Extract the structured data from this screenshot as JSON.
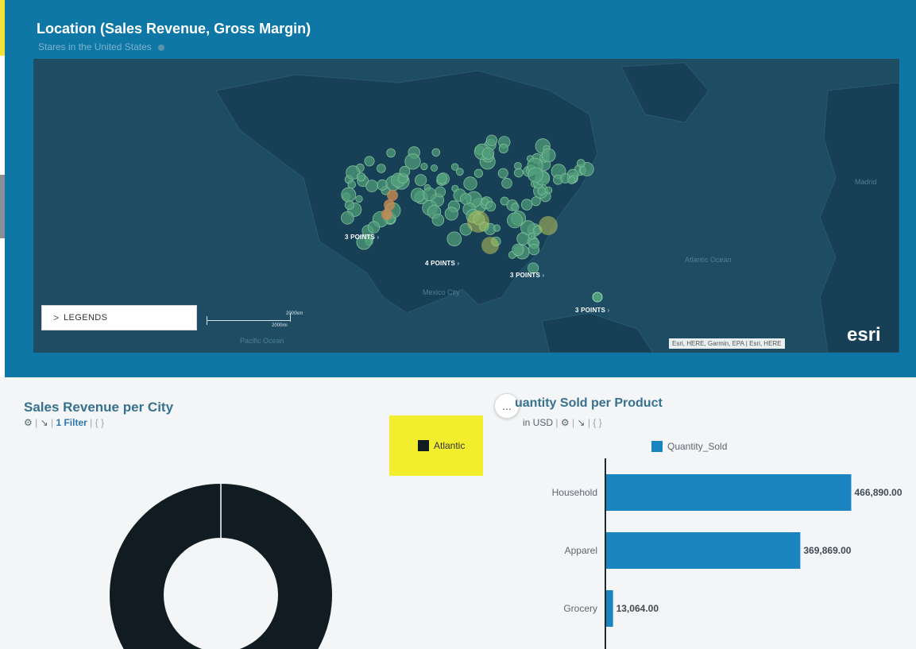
{
  "map": {
    "title": "Location (Sales Revenue, Gross Margin)",
    "subtitle": "Stares in the United States",
    "cluster_labels": [
      "3 POINTS",
      "4 POINTS",
      "3 POINTS",
      "3 POINTS"
    ],
    "ocean_labels": [
      "Atlantic Ocean",
      "Mexico City",
      "Pacific Ocean",
      "Madrid"
    ],
    "legends_label": "LEGENDS",
    "scale_km": "2000km",
    "scale_mi": "2000mi",
    "attribution": "Esri, HERE, Garmin, EPA | Esri, HERE",
    "esri_logo": "esri",
    "colors": {
      "card": "#0e77a6",
      "water": "#1d4c63",
      "land": "#163f55",
      "cluster_point": "#4f9c7a",
      "cluster_ring": "#b9c45a",
      "hot_point": "#c98b52"
    }
  },
  "donut": {
    "title": "Sales Revenue per City",
    "filter_label": "1 Filter",
    "icons": [
      "settings-icon",
      "drill-icon",
      "braces-icon"
    ],
    "legend_label": "Atlantic",
    "legend_color": "#111c22"
  },
  "more_button": "...",
  "bar": {
    "title": "uantity Sold per Product",
    "subtitle": "in USD",
    "legend_label": "Quantity_Sold",
    "color": "#1a84c1"
  },
  "chart_data": [
    {
      "type": "pie",
      "categories": [
        "Atlantic"
      ],
      "values": [
        100
      ],
      "title": "Sales Revenue per City"
    },
    {
      "type": "bar",
      "orientation": "horizontal",
      "title": "uantity Sold per Product",
      "categories": [
        "Household",
        "Apparel",
        "Grocery"
      ],
      "values": [
        466890.0,
        369869.0,
        13064.0
      ],
      "value_labels": [
        "466,890.00",
        "369,869.00",
        "13,064.00"
      ],
      "series": [
        {
          "name": "Quantity_Sold",
          "values": [
            466890.0,
            369869.0,
            13064.0
          ]
        }
      ],
      "xlim": [
        0,
        560000
      ]
    }
  ]
}
